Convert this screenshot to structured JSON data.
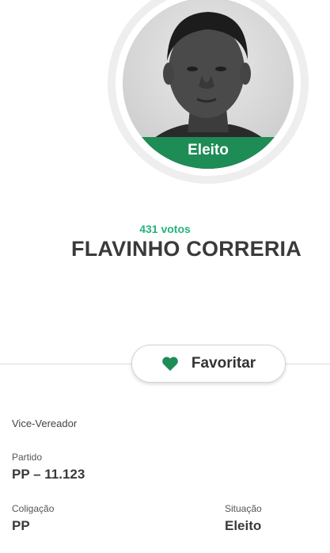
{
  "candidate": {
    "status_badge": "Eleito",
    "votes": "431 votos",
    "name": "FLAVINHO CORRERIA",
    "role": "Vice-Vereador"
  },
  "actions": {
    "favorite_label": "Favoritar"
  },
  "details": {
    "party_label": "Partido",
    "party_value": "PP – 11.123",
    "coalition_label": "Coligação",
    "coalition_value": "PP",
    "situation_label": "Situação",
    "situation_value": "Eleito"
  },
  "colors": {
    "accent_green": "#1e8c55",
    "votes_green": "#26b27a",
    "heart_green": "#1e8c55"
  }
}
